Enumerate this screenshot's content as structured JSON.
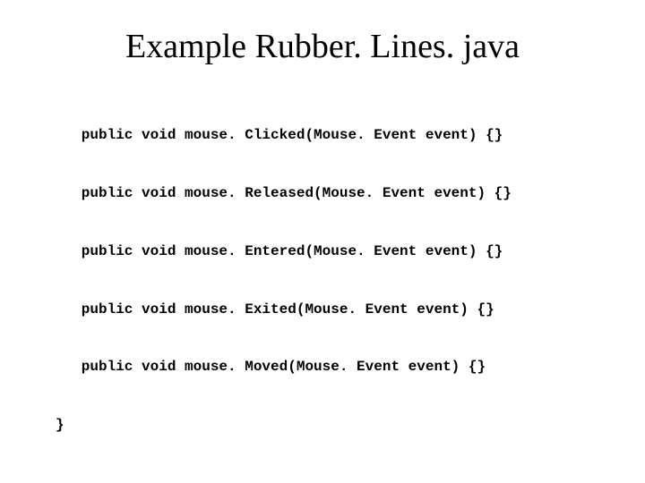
{
  "title": "Example Rubber. Lines. java",
  "code": {
    "lines": [
      "public void mouse. Clicked(Mouse. Event event) {}",
      "public void mouse. Released(Mouse. Event event) {}",
      "public void mouse. Entered(Mouse. Event event) {}",
      "public void mouse. Exited(Mouse. Event event) {}",
      "public void mouse. Moved(Mouse. Event event) {}"
    ],
    "closing": "}"
  }
}
